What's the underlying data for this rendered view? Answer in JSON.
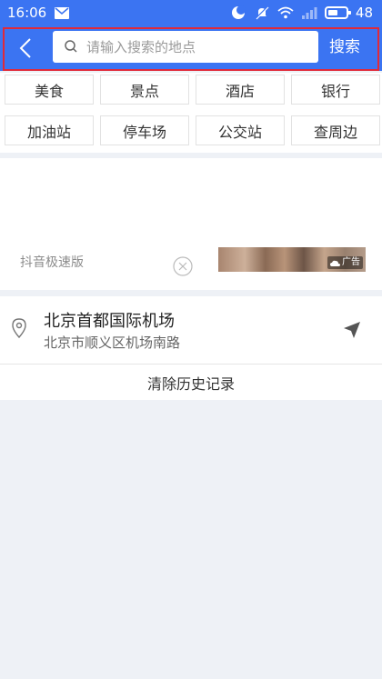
{
  "status_bar": {
    "time": "16:06",
    "battery_level": "48"
  },
  "header": {
    "search_placeholder": "请输入搜索的地点",
    "search_button": "搜索"
  },
  "categories": [
    "美食",
    "景点",
    "酒店",
    "银行",
    "加油站",
    "停车场",
    "公交站",
    "查周边"
  ],
  "ad": {
    "app_name": "抖音极速版",
    "badge": "广告"
  },
  "history": {
    "items": [
      {
        "name": "北京首都国际机场",
        "address": "北京市顺义区机场南路"
      }
    ],
    "clear_label": "清除历史记录"
  },
  "colors": {
    "primary": "#3b74f2",
    "highlight": "#e02a3a"
  }
}
